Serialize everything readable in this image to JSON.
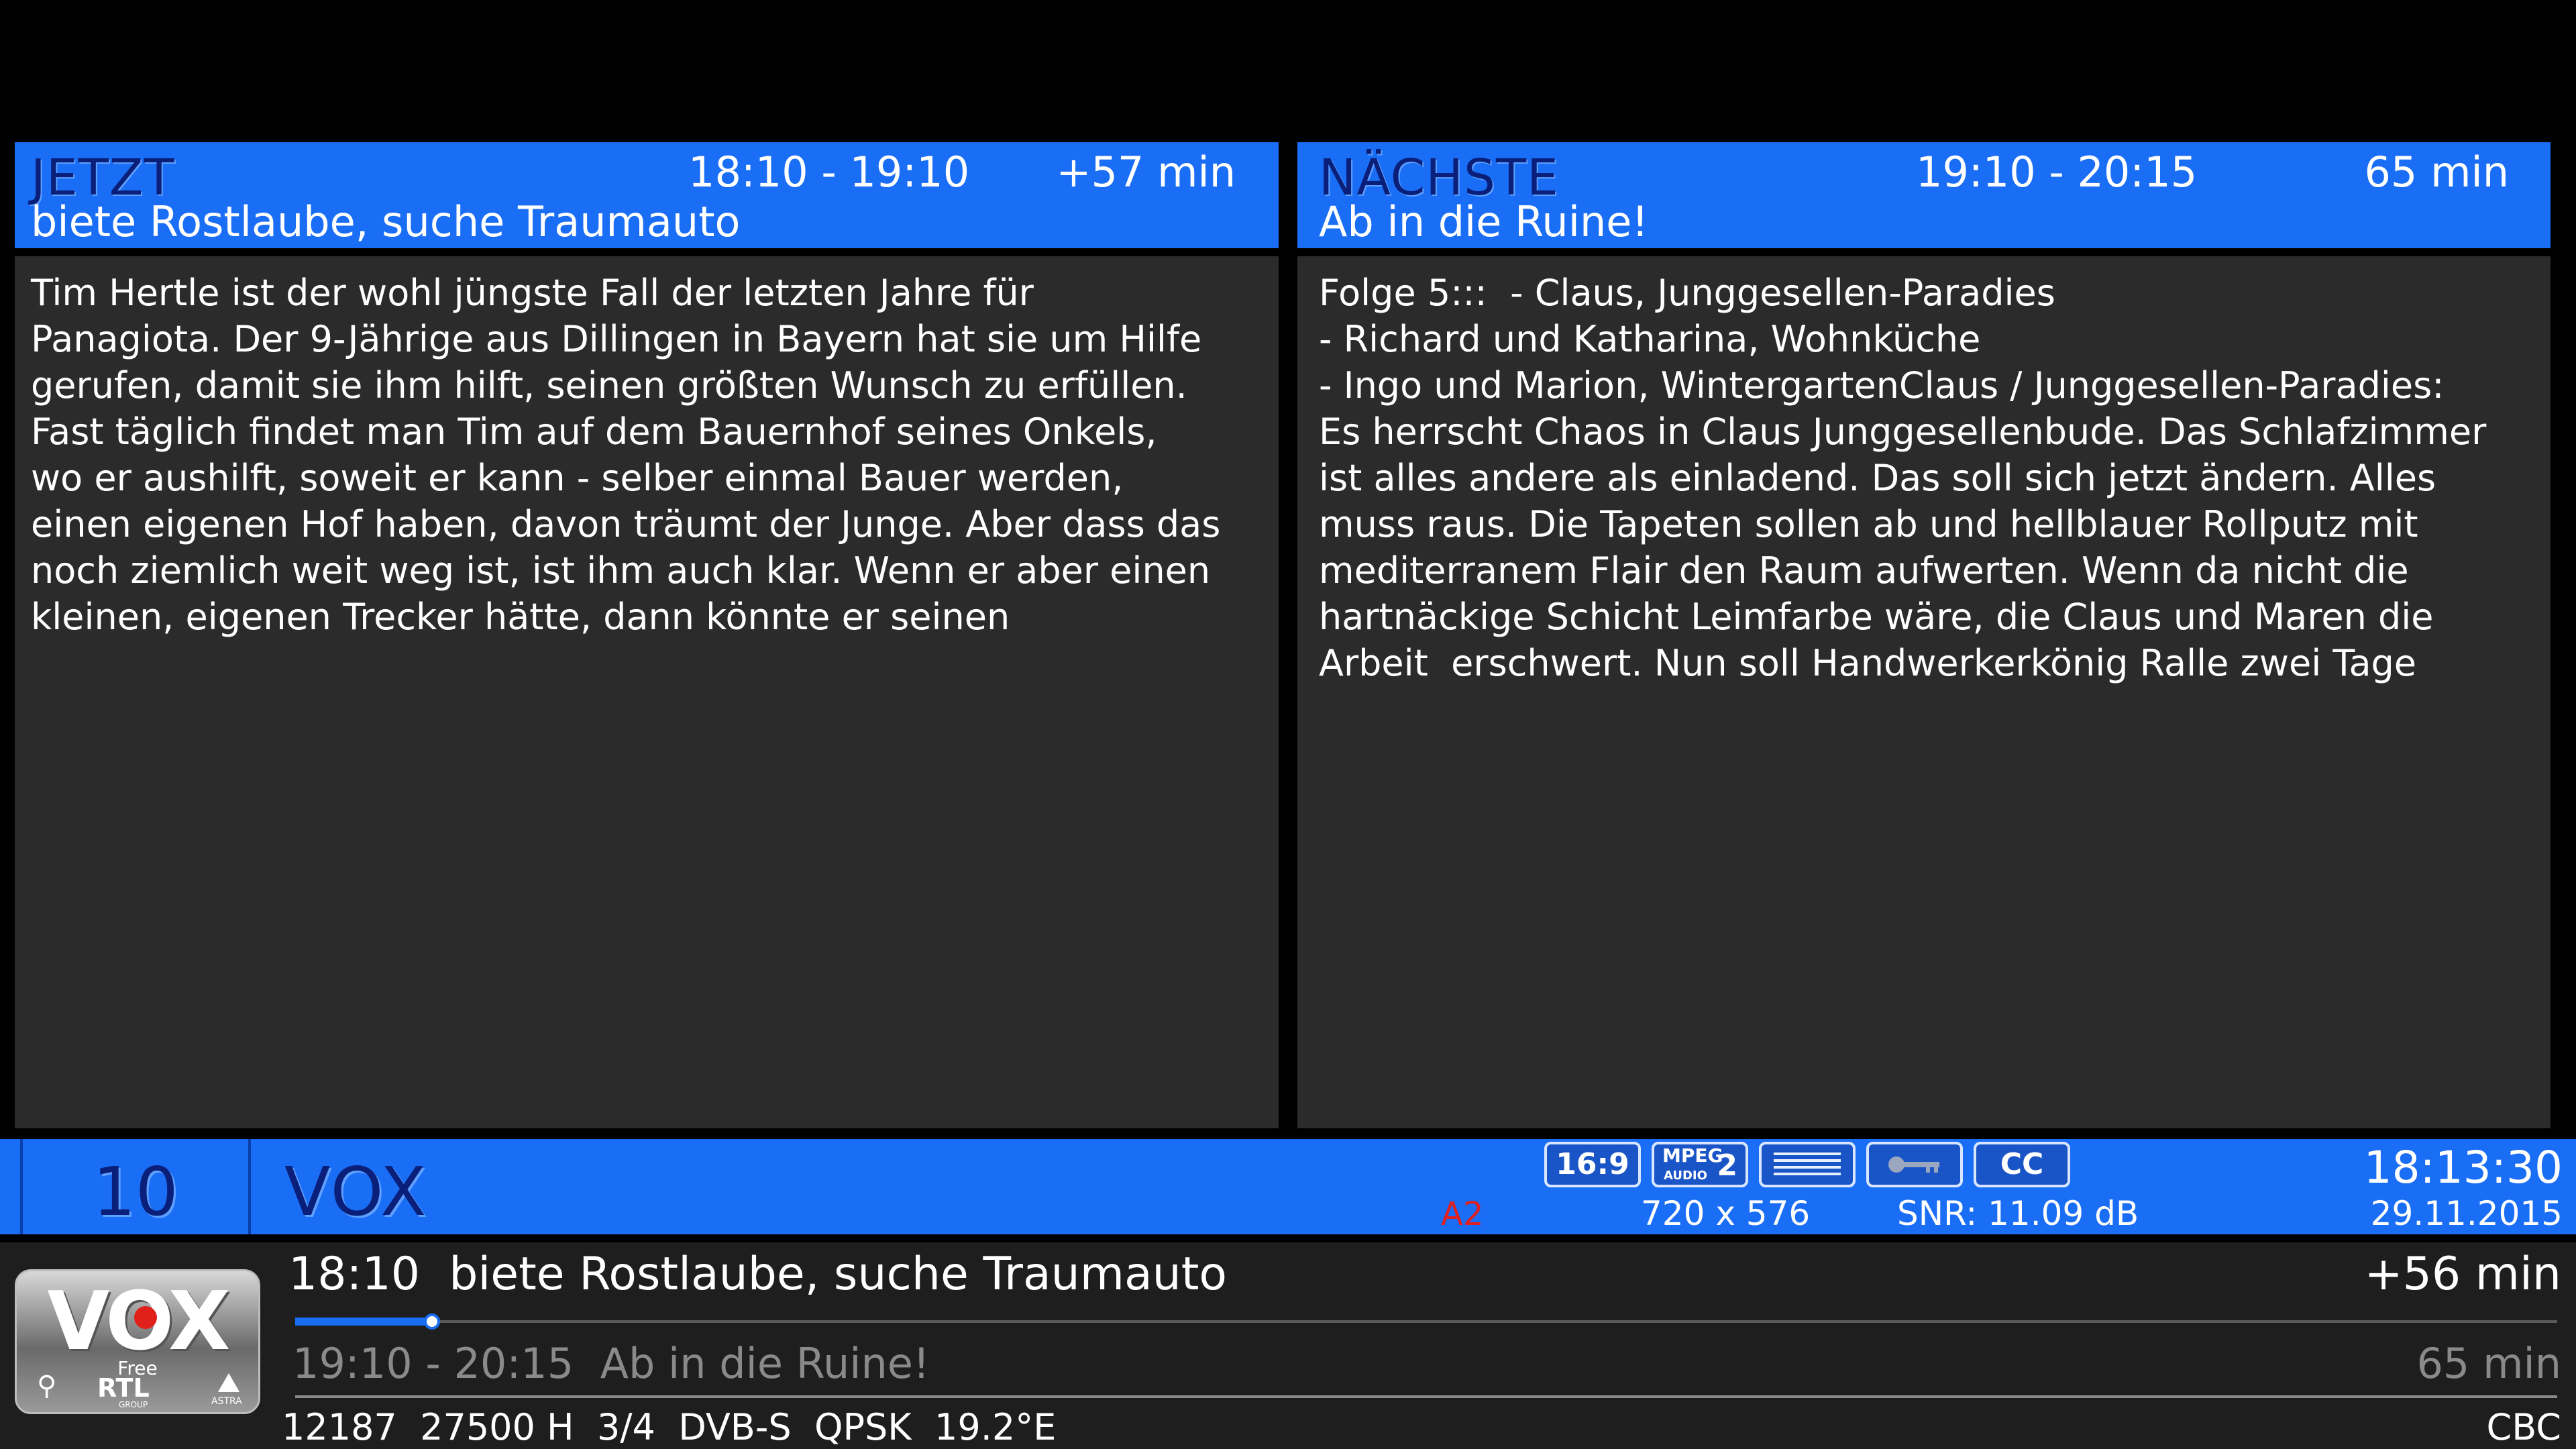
{
  "now": {
    "label": "JETZT",
    "time": "18:10 - 19:10",
    "duration": "+57 min",
    "title": "biete Rostlaube, suche Traumauto",
    "description": "Tim Hertle ist der wohl jüngste Fall der letzten Jahre für\nPanagiota. Der 9-Jährige aus Dillingen in Bayern hat sie um Hilfe\ngerufen, damit sie ihm hilft, seinen größten Wunsch zu erfüllen.\nFast täglich findet man Tim auf dem Bauernhof seines Onkels,\nwo er aushilft, soweit er kann - selber einmal Bauer werden,\neinen eigenen Hof haben, davon träumt der Junge. Aber dass das\nnoch ziemlich weit weg ist, ist ihm auch klar. Wenn er aber einen\nkleinen, eigenen Trecker hätte, dann könnte er seinen"
  },
  "next": {
    "label": "NÄCHSTE",
    "time": "19:10 - 20:15",
    "duration": "65 min",
    "title": "Ab in die Ruine!",
    "description": "Folge 5:::  - Claus, Junggesellen-Paradies\n- Richard und Katharina, Wohnküche\n- Ingo und Marion, WintergartenClaus / Junggesellen-Paradies:\nEs herrscht Chaos in Claus Junggesellenbude. Das Schlafzimmer\nist alles andere als einladend. Das soll sich jetzt ändern. Alles\nmuss raus. Die Tapeten sollen ab und hellblauer Rollputz mit\nmediterranem Flair den Raum aufwerten. Wenn da nicht die\nhartnäckige Schicht Leimfarbe wäre, die Claus und Maren die\nArbeit  erschwert. Nun soll Handwerkerkönig Ralle zwei Tage"
  },
  "channel": {
    "number": "10",
    "name": "VOX",
    "clock": "18:13:30",
    "date": "29.11.2015",
    "audio_tag": "A2",
    "resolution": "720 x 576",
    "snr": "SNR: 11.09 dB",
    "badges": {
      "aspect": "16:9",
      "mpeg_top": "MPEG",
      "mpeg_sub": "AUDIO",
      "mpeg_num": "2",
      "cc": "CC"
    }
  },
  "current": {
    "start": "18:10",
    "title": "biete Rostlaube, suche Traumauto",
    "remaining": "+56 min",
    "progress": 0.06
  },
  "following": {
    "time": "19:10 - 20:15",
    "title": "Ab in die Ruine!",
    "duration": "65 min"
  },
  "tuner": {
    "info": "12187  27500 H  3/4  DVB-S  QPSK  19.2°E",
    "ca": "CBC"
  },
  "logo": {
    "brand": "VOX",
    "free": "Free",
    "group": "RTL",
    "group_sub": "GROUP",
    "sat": "ASTRA"
  },
  "colors": {
    "accent": "#1a6ef5",
    "panel": "#2b2b2b",
    "header_label": "#0a1f7a",
    "audio_tag": "#e02020",
    "muted_text": "#8a8a8a"
  }
}
